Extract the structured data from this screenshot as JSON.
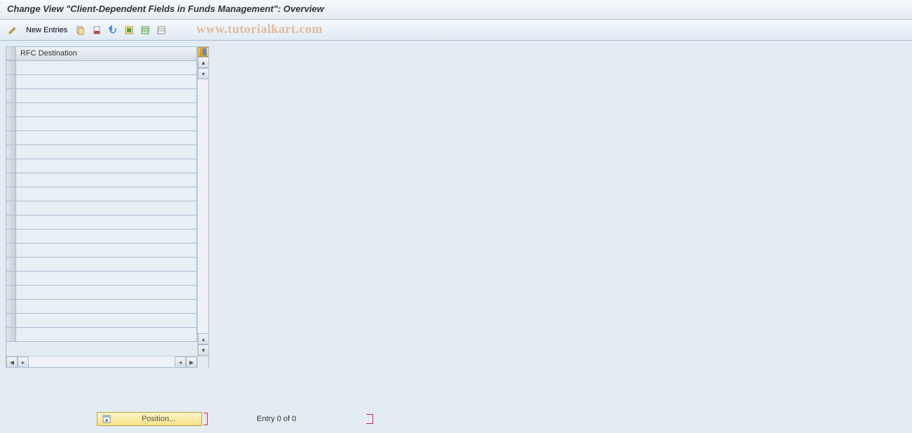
{
  "title": "Change View \"Client-Dependent Fields in Funds Management\": Overview",
  "toolbar": {
    "new_entries_label": "New Entries"
  },
  "watermark": "www.tutorialkart.com",
  "table": {
    "column_header": "RFC Destination",
    "row_count": 20
  },
  "footer": {
    "position_label": "Position...",
    "entry_text": "Entry 0 of 0"
  }
}
